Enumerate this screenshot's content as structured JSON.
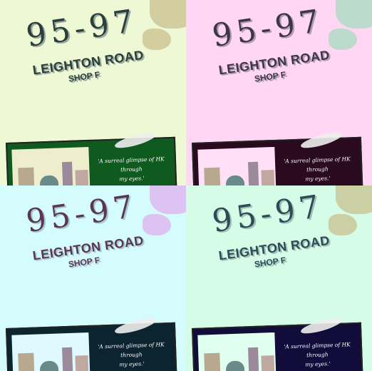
{
  "sign": {
    "number": "95-97",
    "street": "LEIGHTON ROAD",
    "unit": "SHOP F"
  },
  "poster": {
    "quote_line1": "'A surreal glimpse of HK through",
    "quote_line2": "my eyes.'"
  },
  "panels": [
    {
      "wall": "#eef8d4",
      "blotch": "#c8c08e",
      "ink": "#2a3f3a",
      "shadow": "#9aa9a0",
      "poster_bg": "#0f5a1e",
      "photo_bg": "#efeecc"
    },
    {
      "wall": "#ffd6f4",
      "blotch": "#a7dcc0",
      "ink": "#3d3648",
      "shadow": "#b09ab8",
      "poster_bg": "#2a0a1e",
      "photo_bg": "#ffe0f6"
    },
    {
      "wall": "#d4fcfc",
      "blotch": "#e0b0ee",
      "ink": "#5a3650",
      "shadow": "#a8c8d8",
      "poster_bg": "#0c2430",
      "photo_bg": "#e0f8ff"
    },
    {
      "wall": "#d4fce6",
      "blotch": "#c8c08e",
      "ink": "#2f4a55",
      "shadow": "#9ec0b8",
      "poster_bg": "#120c3a",
      "photo_bg": "#e0fff0"
    }
  ]
}
